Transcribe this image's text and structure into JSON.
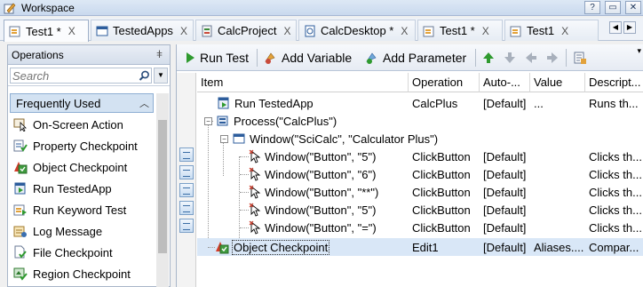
{
  "window": {
    "title": "Workspace",
    "help_label": "?",
    "min_label": "▭",
    "close_label": "✕"
  },
  "tabs": [
    {
      "label": "Test1 *",
      "close": "X",
      "icon": "test-icon"
    },
    {
      "label": "TestedApps",
      "close": "X",
      "icon": "window-icon"
    },
    {
      "label": "CalcProject",
      "close": "X",
      "icon": "project-icon"
    },
    {
      "label": "CalcDesktop *",
      "close": "X",
      "icon": "desktop-icon"
    },
    {
      "label": "Test1 *",
      "close": "X",
      "icon": "test-icon"
    },
    {
      "label": "Test1",
      "close": "X",
      "icon": "test-icon"
    }
  ],
  "tab_nav": {
    "prev": "◀",
    "next": "▶"
  },
  "operations": {
    "title": "Operations",
    "pin": "ǂ",
    "search_placeholder": "Search",
    "group": "Frequently Used",
    "group_chevron": "︿",
    "items": [
      {
        "label": "On-Screen Action",
        "icon": "on-screen-action-icon"
      },
      {
        "label": "Property Checkpoint",
        "icon": "property-checkpoint-icon"
      },
      {
        "label": "Object Checkpoint",
        "icon": "object-checkpoint-icon"
      },
      {
        "label": "Run TestedApp",
        "icon": "run-testedapp-icon"
      },
      {
        "label": "Run Keyword Test",
        "icon": "run-keyword-test-icon"
      },
      {
        "label": "Log Message",
        "icon": "log-message-icon"
      },
      {
        "label": "File Checkpoint",
        "icon": "file-checkpoint-icon"
      },
      {
        "label": "Region Checkpoint",
        "icon": "region-checkpoint-icon"
      }
    ]
  },
  "toolbar": {
    "run_test": "Run Test",
    "add_variable": "Add Variable",
    "add_parameter": "Add Parameter",
    "more": "▾"
  },
  "grid": {
    "columns": [
      "Item",
      "Operation",
      "Auto-...",
      "Value",
      "Descript..."
    ],
    "rows": [
      {
        "item": "Run TestedApp",
        "operation": "CalcPlus",
        "auto": "[Default]",
        "value": "...",
        "description": "Runs th...",
        "icon": "run-testedapp-icon"
      },
      {
        "item": "Process(\"CalcPlus\")",
        "operation": "",
        "auto": "",
        "value": "",
        "description": "",
        "icon": "process-icon",
        "expander": "−"
      },
      {
        "item": "Window(\"SciCalc\", \"Calculator Plus\")",
        "operation": "",
        "auto": "",
        "value": "",
        "description": "",
        "icon": "window-icon",
        "expander": "−"
      },
      {
        "item": "Window(\"Button\", \"5\")",
        "operation": "ClickButton",
        "auto": "[Default]",
        "value": "",
        "description": "Clicks th...",
        "icon": "click-icon"
      },
      {
        "item": "Window(\"Button\", \"6\")",
        "operation": "ClickButton",
        "auto": "[Default]",
        "value": "",
        "description": "Clicks th...",
        "icon": "click-icon"
      },
      {
        "item": "Window(\"Button\", \"**\")",
        "operation": "ClickButton",
        "auto": "[Default]",
        "value": "",
        "description": "Clicks th...",
        "icon": "click-icon"
      },
      {
        "item": "Window(\"Button\", \"5\")",
        "operation": "ClickButton",
        "auto": "[Default]",
        "value": "",
        "description": "Clicks th...",
        "icon": "click-icon"
      },
      {
        "item": "Window(\"Button\", \"=\")",
        "operation": "ClickButton",
        "auto": "[Default]",
        "value": "",
        "description": "Clicks th...",
        "icon": "click-icon"
      },
      {
        "item": "Object Checkpoint",
        "operation": "Edit1",
        "auto": "[Default]",
        "value": "Aliases....",
        "description": "Compar...",
        "icon": "object-checkpoint-icon"
      }
    ]
  }
}
